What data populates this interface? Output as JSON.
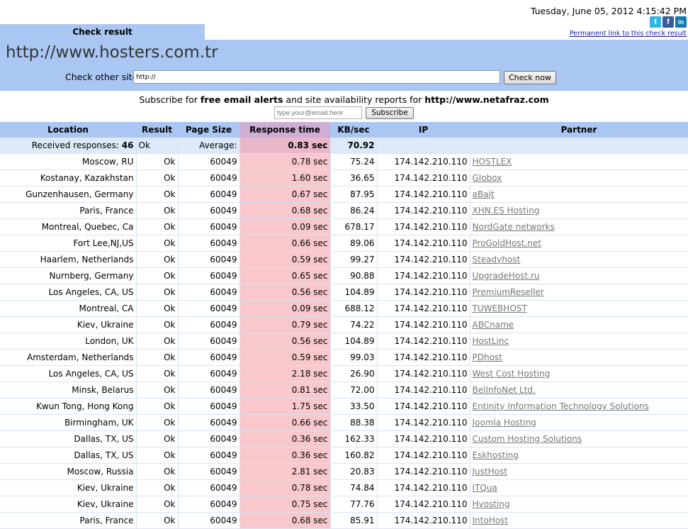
{
  "datetime": "Tuesday, June 05, 2012 4:15:42 PM",
  "social": {
    "twitter": "t",
    "facebook": "f",
    "linkedin": "in"
  },
  "permalink": "Permanent link to this check result",
  "tab_label": "Check result",
  "site": "http://www.hosters.com.tr",
  "check_label": "Check other site:",
  "check_input_value": "http://",
  "check_button": "Check now",
  "subscribe": {
    "pre": "Subscribe for ",
    "bold1": "free email alerts",
    "mid": " and site availability reports for ",
    "bold2": "http://www.netafraz.com",
    "email_placeholder": "type.your@email.here",
    "button": "Subscribe"
  },
  "table": {
    "headers": [
      "Location",
      "Result",
      "Page Size",
      "Response time",
      "KB/sec",
      "IP",
      "Partner"
    ],
    "summary": {
      "label": "Received responses:",
      "count": "46",
      "result": "Ok",
      "avg_label": "Average:",
      "avg_time": "0.83 sec",
      "avg_kb": "70.92"
    },
    "rows": [
      {
        "location": "Moscow, RU",
        "result": "Ok",
        "size": "60049",
        "time": "0.78 sec",
        "kb": "75.24",
        "ip": "174.142.210.110",
        "partner": "HOSTLEX"
      },
      {
        "location": "Kostanay, Kazakhstan",
        "result": "Ok",
        "size": "60049",
        "time": "1.60 sec",
        "kb": "36.65",
        "ip": "174.142.210.110",
        "partner": "Globox"
      },
      {
        "location": "Gunzenhausen, Germany",
        "result": "Ok",
        "size": "60049",
        "time": "0.67 sec",
        "kb": "87.95",
        "ip": "174.142.210.110",
        "partner": "aBajt"
      },
      {
        "location": "Paris, France",
        "result": "Ok",
        "size": "60049",
        "time": "0.68 sec",
        "kb": "86.24",
        "ip": "174.142.210.110",
        "partner": "XHN.ES Hosting"
      },
      {
        "location": "Montreal, Quebec, Ca",
        "result": "Ok",
        "size": "60049",
        "time": "0.09 sec",
        "kb": "678.17",
        "ip": "174.142.210.110",
        "partner": "NordGate networks"
      },
      {
        "location": "Fort Lee,NJ,US",
        "result": "Ok",
        "size": "60049",
        "time": "0.66 sec",
        "kb": "89.06",
        "ip": "174.142.210.110",
        "partner": "ProGoldHost.net"
      },
      {
        "location": "Haarlem, Netherlands",
        "result": "Ok",
        "size": "60049",
        "time": "0.59 sec",
        "kb": "99.27",
        "ip": "174.142.210.110",
        "partner": "Steadyhost"
      },
      {
        "location": "Nurnberg, Germany",
        "result": "Ok",
        "size": "60049",
        "time": "0.65 sec",
        "kb": "90.88",
        "ip": "174.142.210.110",
        "partner": "UpgradeHost.ru"
      },
      {
        "location": "Los Angeles, CA, US",
        "result": "Ok",
        "size": "60049",
        "time": "0.56 sec",
        "kb": "104.89",
        "ip": "174.142.210.110",
        "partner": "PremiumReseller"
      },
      {
        "location": "Montreal, CA",
        "result": "Ok",
        "size": "60049",
        "time": "0.09 sec",
        "kb": "688.12",
        "ip": "174.142.210.110",
        "partner": "TUWEBHOST"
      },
      {
        "location": "Kiev, Ukraine",
        "result": "Ok",
        "size": "60049",
        "time": "0.79 sec",
        "kb": "74.22",
        "ip": "174.142.210.110",
        "partner": "ABCname"
      },
      {
        "location": "London, UK",
        "result": "Ok",
        "size": "60049",
        "time": "0.56 sec",
        "kb": "104.89",
        "ip": "174.142.210.110",
        "partner": "HostLinc"
      },
      {
        "location": "Amsterdam, Netherlands",
        "result": "Ok",
        "size": "60049",
        "time": "0.59 sec",
        "kb": "99.03",
        "ip": "174.142.210.110",
        "partner": "PDhost"
      },
      {
        "location": "Los Angeles, CA, US",
        "result": "Ok",
        "size": "60049",
        "time": "2.18 sec",
        "kb": "26.90",
        "ip": "174.142.210.110",
        "partner": "West Cost Hosting"
      },
      {
        "location": "Minsk, Belarus",
        "result": "Ok",
        "size": "60049",
        "time": "0.81 sec",
        "kb": "72.00",
        "ip": "174.142.210.110",
        "partner": "BelInfoNet Ltd."
      },
      {
        "location": "Kwun Tong, Hong Kong",
        "result": "Ok",
        "size": "60049",
        "time": "1.75 sec",
        "kb": "33.50",
        "ip": "174.142.210.110",
        "partner": "Entinity Information Technology Solutions"
      },
      {
        "location": "Birmingham, UK",
        "result": "Ok",
        "size": "60049",
        "time": "0.66 sec",
        "kb": "88.38",
        "ip": "174.142.210.110",
        "partner": "Joomla Hosting"
      },
      {
        "location": "Dallas, TX, US",
        "result": "Ok",
        "size": "60049",
        "time": "0.36 sec",
        "kb": "162.33",
        "ip": "174.142.210.110",
        "partner": "Custom Hosting Solutions"
      },
      {
        "location": "Dallas, TX, US",
        "result": "Ok",
        "size": "60049",
        "time": "0.36 sec",
        "kb": "160.82",
        "ip": "174.142.210.110",
        "partner": "Eskhosting"
      },
      {
        "location": "Moscow, Russia",
        "result": "Ok",
        "size": "60049",
        "time": "2.81 sec",
        "kb": "20.83",
        "ip": "174.142.210.110",
        "partner": "JustHost"
      },
      {
        "location": "Kiev, Ukraine",
        "result": "Ok",
        "size": "60049",
        "time": "0.78 sec",
        "kb": "74.84",
        "ip": "174.142.210.110",
        "partner": "ITQua"
      },
      {
        "location": "Kiev, Ukraine",
        "result": "Ok",
        "size": "60049",
        "time": "0.75 sec",
        "kb": "77.76",
        "ip": "174.142.210.110",
        "partner": "Hvosting"
      },
      {
        "location": "Paris, France",
        "result": "Ok",
        "size": "60049",
        "time": "0.68 sec",
        "kb": "85.91",
        "ip": "174.142.210.110",
        "partner": "IntoHost"
      }
    ]
  }
}
